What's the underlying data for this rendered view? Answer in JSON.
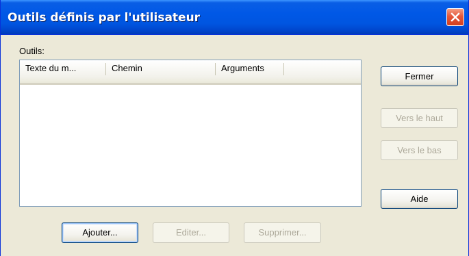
{
  "window": {
    "title": "Outils définis par l'utilisateur",
    "close_glyph": "✕"
  },
  "main": {
    "list_label": "Outils:",
    "columns": [
      {
        "label": "Texte du m..."
      },
      {
        "label": "Chemin"
      },
      {
        "label": "Arguments"
      }
    ],
    "rows": []
  },
  "side_buttons": {
    "close": "Fermer",
    "move_up": "Vers le haut",
    "move_down": "Vers le bas",
    "help": "Aide"
  },
  "bottom_buttons": {
    "add": "Ajouter...",
    "edit": "Editer...",
    "delete": "Supprimer..."
  },
  "colors": {
    "titlebar": "#0058e6",
    "dialog_background": "#ece9d8",
    "close_button": "#e5573a",
    "disabled_text": "#aca899"
  }
}
